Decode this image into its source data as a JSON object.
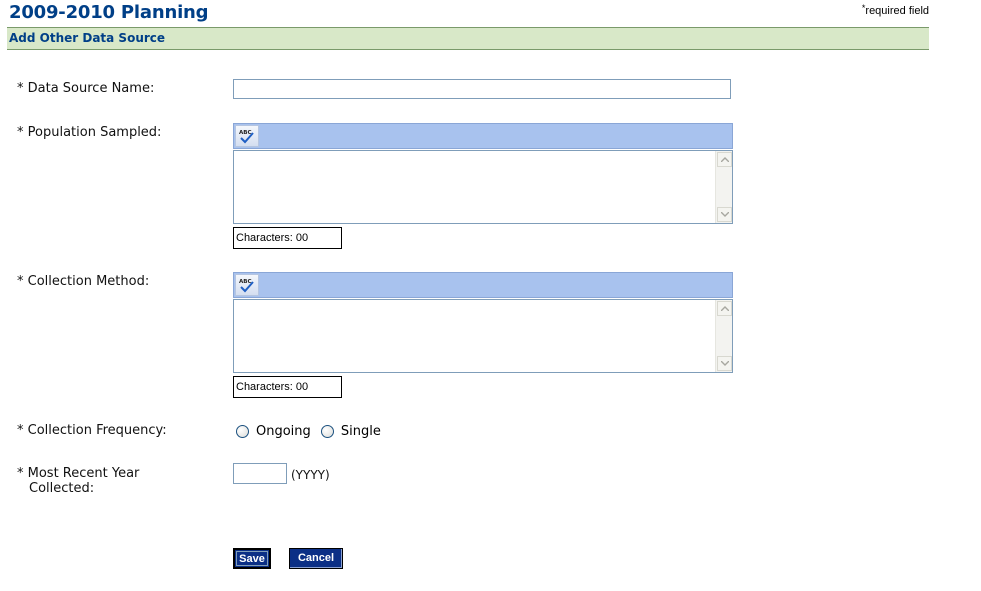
{
  "header": {
    "title": "2009-2010 Planning",
    "required_mark": "*",
    "required_text": "required field"
  },
  "section": {
    "title": "Add Other Data Source"
  },
  "form": {
    "data_source_name": {
      "label": "* Data Source Name:",
      "value": ""
    },
    "population_sampled": {
      "label": "* Population Sampled:",
      "value": "",
      "counter": "Characters: 00",
      "spellcheck_icon": "spellcheck-icon"
    },
    "collection_method": {
      "label": "* Collection Method:",
      "value": "",
      "counter": "Characters: 00",
      "spellcheck_icon": "spellcheck-icon"
    },
    "collection_frequency": {
      "label": "* Collection Frequency:",
      "options": [
        "Ongoing",
        "Single"
      ]
    },
    "most_recent_year": {
      "label_line1": "* Most Recent Year",
      "label_line2": "Collected:",
      "value": "",
      "hint": "(YYYY)"
    }
  },
  "buttons": {
    "save": "Save",
    "cancel": "Cancel"
  },
  "colors": {
    "title": "#003f87",
    "section_bar": "#d8e8c8",
    "toolbar": "#a8c2ee",
    "button": "#0b2f86"
  }
}
